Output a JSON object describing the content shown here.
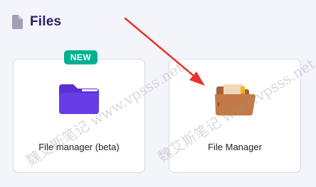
{
  "header": {
    "title": "Files",
    "icon": "file-icon"
  },
  "cards": [
    {
      "label": "File manager (beta)",
      "icon": "purple-folder-icon",
      "badge": "NEW",
      "badge_color": "#00b090",
      "icon_color": "#673de6"
    },
    {
      "label": "File Manager",
      "icon": "brown-folder-icon",
      "icon_color": "#c47a46"
    }
  ],
  "annotation": {
    "arrow_color": "#e8332a",
    "arrow_icon": "red-arrow-icon"
  },
  "watermark": {
    "text": "魏艾斯笔记 www.vpsss.net"
  },
  "colors": {
    "background": "#f4f5fb",
    "title": "#2f1c6a",
    "card_border": "#d8dae6"
  }
}
